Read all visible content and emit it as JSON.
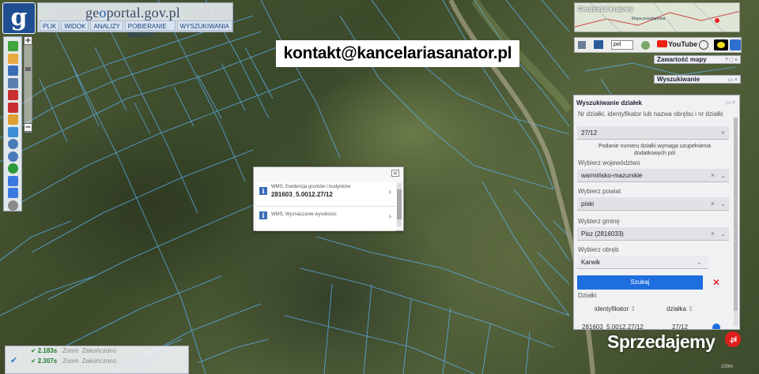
{
  "app": {
    "logo_letter": "g",
    "brand_prefix": "ge",
    "brand_o": "o",
    "brand_rest": "portal.gov.pl",
    "menu": [
      "PLIK",
      "WIDOK",
      "ANALIZY",
      "POBIERANIE DANYCH",
      "WYSZUKIWANIA"
    ]
  },
  "banner": {
    "text": "kontakt@kancelariasanator.pl"
  },
  "toolbar": {
    "tools": [
      {
        "name": "info-icon",
        "color": "#3fa43a"
      },
      {
        "name": "hand-pan-icon",
        "color": "#e9a840"
      },
      {
        "name": "layers-icon",
        "color": "#3b6db6"
      },
      {
        "name": "print-icon",
        "color": "#5a7fae"
      },
      {
        "name": "measure-icon",
        "color": "#c83030"
      },
      {
        "name": "draw-icon",
        "color": "#c83030"
      },
      {
        "name": "pencil-icon",
        "color": "#e0a030"
      },
      {
        "name": "coordinates-icon",
        "color": "#3b8ed6"
      },
      {
        "name": "zoom-in-icon",
        "color": "#4a7ab8"
      },
      {
        "name": "zoom-out-icon",
        "color": "#4a7ab8"
      },
      {
        "name": "globe-icon",
        "color": "#2a9a3a"
      },
      {
        "name": "back-icon",
        "color": "#3a7ae0"
      },
      {
        "name": "forward-icon",
        "color": "#3a7ae0"
      },
      {
        "name": "compass-icon",
        "color": "#8a8a8a"
      }
    ],
    "zoom_plus": "+",
    "zoom_minus": "−"
  },
  "popup": {
    "close": "×",
    "items": [
      {
        "title": "WMS, Ewidencja gruntów i budynków",
        "value": "281603_5.0012.27/12"
      },
      {
        "title": "WMS, Wyznaczanie wysokości",
        "value": ""
      }
    ]
  },
  "minimap": {
    "title": "Geoportal krajowy",
    "subtitle": "Mapa przeglądowa"
  },
  "top_icons": {
    "language": "pol",
    "youtube": "YouTube"
  },
  "tabs": {
    "contents": "Zawartość mapy",
    "contents_ctrl": "? □ ×",
    "search": "Wyszukiwanie",
    "search_ctrl": "▭ ×"
  },
  "parcel_search": {
    "header": "Wyszukiwanie działek",
    "header_ctrl": "▭ ×",
    "id_label": "Nr działki, identyfikator lub nazwa obrębu i nr działki",
    "id_value": "27/12",
    "note": "Podanie numeru działki wymaga uzupełnienia dodatkowych pól",
    "voivodeship_label": "Wybierz województwo",
    "voivodeship_value": "warmińsko-mazurskie",
    "county_label": "Wybierz powiat",
    "county_value": "piski",
    "commune_label": "Wybierz gminę",
    "commune_value": "Pisz (2816033)",
    "precinct_label": "Wybierz obręb",
    "precinct_value": "Karwik",
    "search_button": "Szukaj",
    "clear_button": "✕",
    "results_label": "Działki",
    "columns": [
      "identyfikator",
      "działka"
    ],
    "rows": [
      {
        "identyfikator": "281603_5.0012.27/12",
        "dzialka": "27/12"
      }
    ]
  },
  "status": {
    "check": "✔",
    "rows": [
      {
        "time": "2.183s",
        "action": "Zoom",
        "state": "Zakończono"
      },
      {
        "time": "2.307s",
        "action": "Zoom",
        "state": "Zakończono"
      }
    ]
  },
  "watermark": {
    "text": "Sprzedajemy",
    "badge": ".pl"
  },
  "scale": "100m"
}
